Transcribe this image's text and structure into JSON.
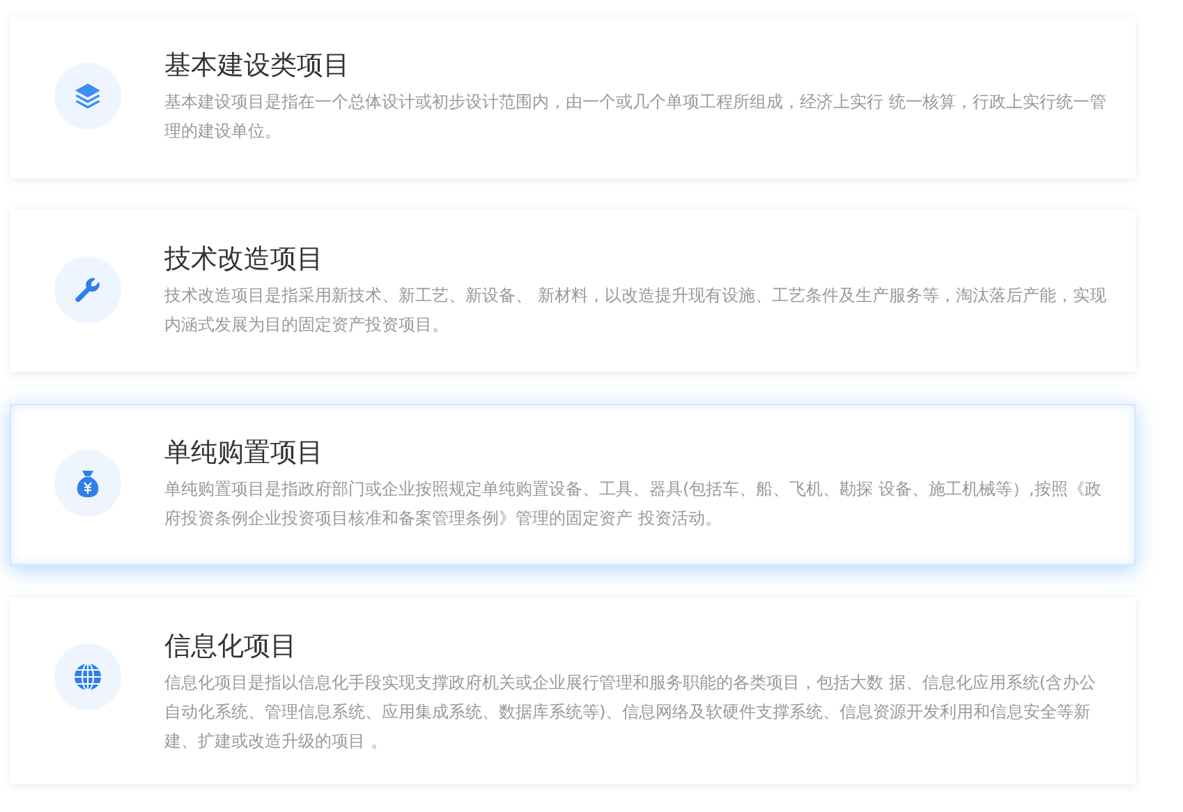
{
  "projects": [
    {
      "kind": "layers",
      "title": "基本建设类项目",
      "description": "基本建设项目是指在一个总体设计或初步设计范围内，由一个或几个单项工程所组成，经济上实行 统一核算，行政上实行统一管理的建设单位。",
      "highlighted": false
    },
    {
      "kind": "wrench",
      "title": "技术改造项目",
      "description": "技术改造项目是指采用新技术、新工艺、新设备、 新材料，以改造提升现有设施、工艺条件及生产服务等，淘汰落后产能，实现内涵式发展为目的固定资产投资项目。",
      "highlighted": false
    },
    {
      "kind": "moneybag",
      "title": "单纯购置项目",
      "description": "单纯购置项目是指政府部门或企业按照规定单纯购置设备、工具、器具(包括车、船、飞机、勘探 设备、施工机械等）,按照《政府投资条例企业投资项目核准和备案管理条例》管理的固定资产 投资活动。",
      "highlighted": true
    },
    {
      "kind": "globe",
      "title": "信息化项目",
      "description": "信息化项目是指以信息化手段实现支撑政府机关或企业展行管理和服务职能的各类项目，包括大数 据、信息化应用系统(含办公自动化系统、管理信息系统、应用集成系统、数据库系统等)、信息网络及软硬件支撑系统、信息资源开发利用和信息安全等新建、扩建或改造升级的项目 。",
      "highlighted": false
    }
  ]
}
